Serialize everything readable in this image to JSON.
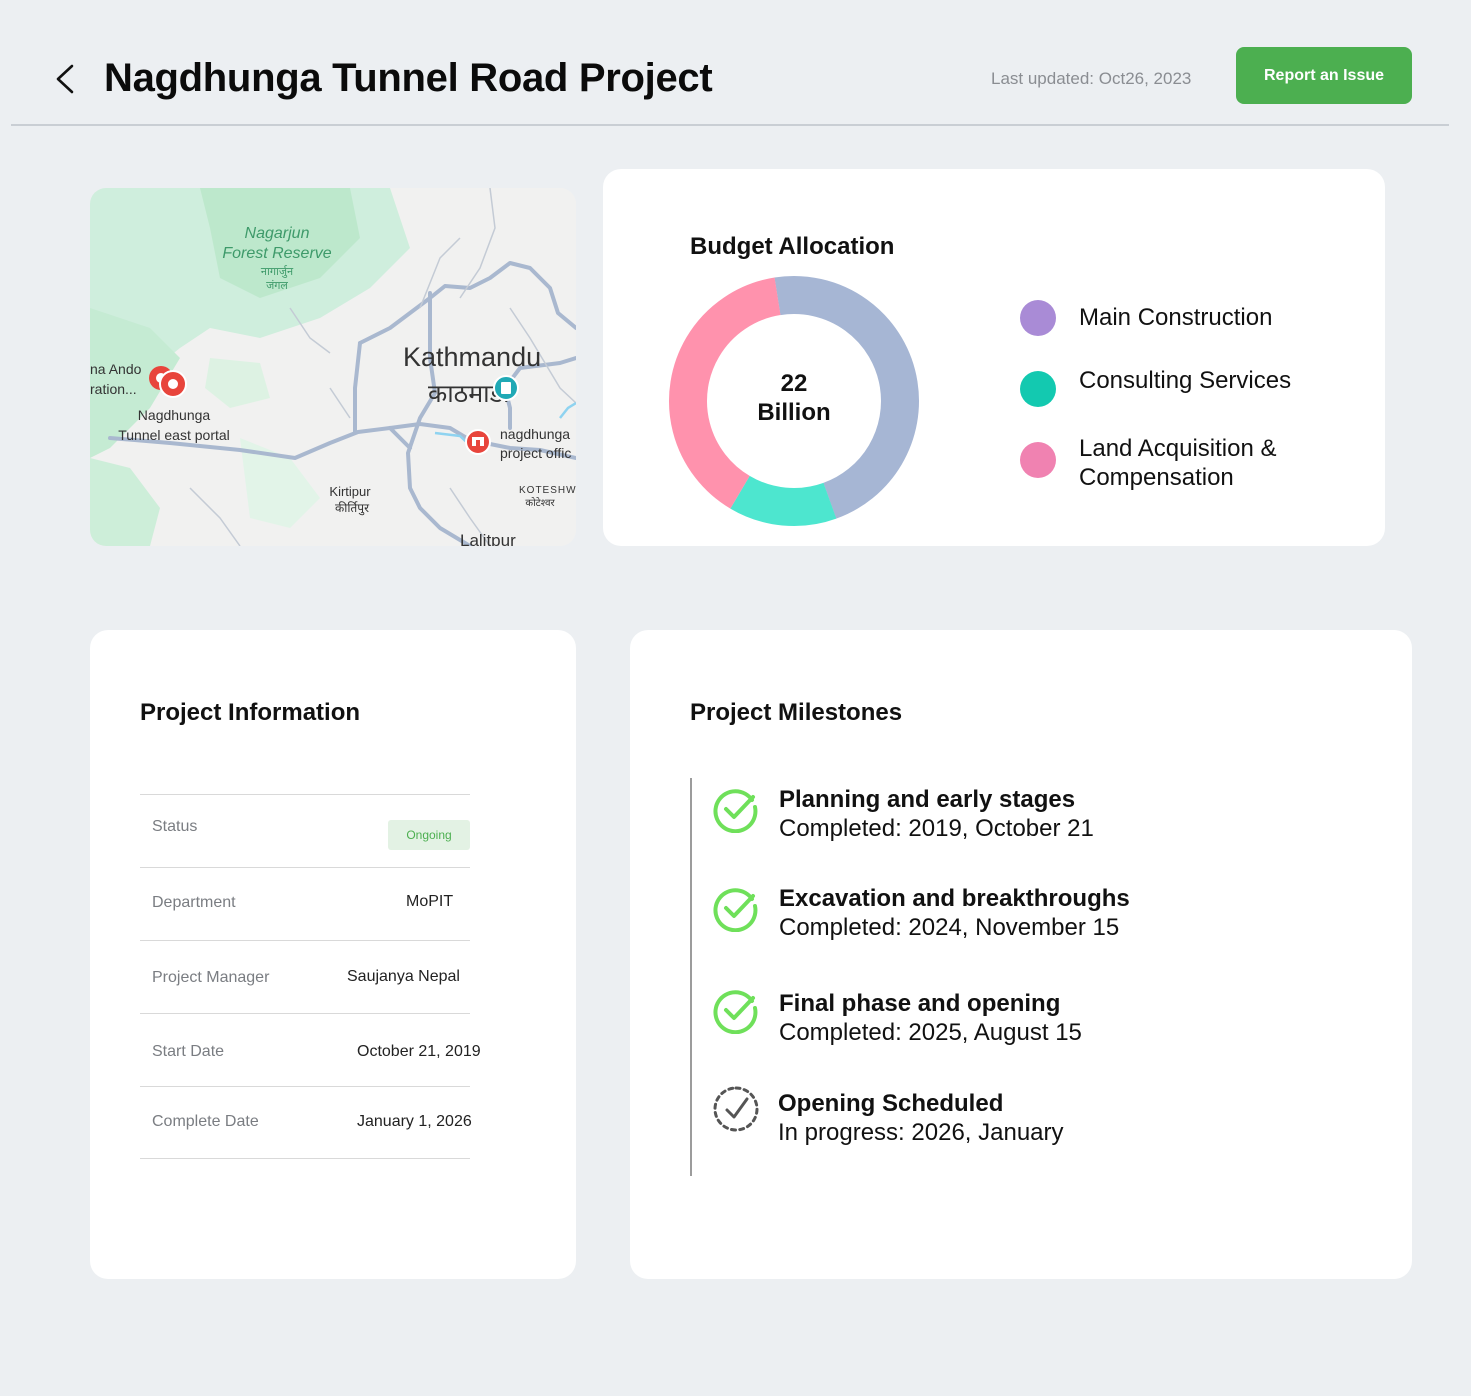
{
  "header": {
    "title": "Nagdhunga Tunnel Road Project",
    "last_updated": "Last updated: Oct26, 2023",
    "report_button": "Report an Issue"
  },
  "map": {
    "labels": {
      "forest_1": "Nagarjun",
      "forest_2": "Forest Reserve",
      "forest_np_1": "नागार्जुन",
      "forest_np_2": "जंगल",
      "city": "Kathmandu",
      "city_np": "काठमाडौं",
      "ando_1": "na Ando",
      "ando_2": "ration...",
      "portal_1": "Nagdhunga",
      "portal_2": "Tunnel east portal",
      "office_1": "nagdhunga",
      "office_2": "project offic",
      "kirtipur": "Kirtipur",
      "kirtipur_np": "कीर्तिपुर",
      "koteshwor": "KOTESHW",
      "koteshwor_np": "कोटेश्वर",
      "lalitpur": "Lalitpur"
    }
  },
  "budget": {
    "title": "Budget Allocation",
    "total_line1": "22",
    "total_line2": "Billion",
    "chart_data": {
      "type": "pie",
      "title": "Budget Allocation",
      "center_label": "22 Billion",
      "segments": [
        {
          "label": "Main Construction",
          "value": 0.47,
          "ring_color": "#a6b6d4",
          "legend_color": "#a98bd6"
        },
        {
          "label": "Consulting Services",
          "value": 0.14,
          "ring_color": "#4de6cf",
          "legend_color": "#13c9b0"
        },
        {
          "label": "Land Acquisition & Compensation",
          "value": 0.39,
          "ring_color": "#ff92ad",
          "legend_color": "#f082b1"
        }
      ]
    }
  },
  "project_info": {
    "title": "Project Information",
    "rows": [
      {
        "key": "Status",
        "value": "Ongoing"
      },
      {
        "key": "Department",
        "value": "MoPIT"
      },
      {
        "key": "Project Manager",
        "value": "Saujanya Nepal"
      },
      {
        "key": "Start Date",
        "value": "October 21, 2019"
      },
      {
        "key": "Complete Date",
        "value": "January 1, 2026"
      }
    ]
  },
  "milestones": {
    "title": "Project Milestones",
    "items": [
      {
        "title": "Planning and early stages",
        "subtitle": "Completed: 2019, October 21",
        "icon": "check-circle-icon",
        "state": "completed"
      },
      {
        "title": "Excavation and breakthroughs",
        "subtitle": "Completed: 2024, November 15",
        "icon": "check-circle-icon",
        "state": "completed"
      },
      {
        "title": "Final phase and opening",
        "subtitle": "Completed: 2025, August 15",
        "icon": "check-circle-icon",
        "state": "completed"
      },
      {
        "title": "Opening Scheduled",
        "subtitle": "In progress: 2026, January",
        "icon": "dashed-check-circle-icon",
        "state": "in-progress"
      }
    ],
    "colors": {
      "completed": "#6fe05a",
      "in_progress": "#555555"
    }
  }
}
